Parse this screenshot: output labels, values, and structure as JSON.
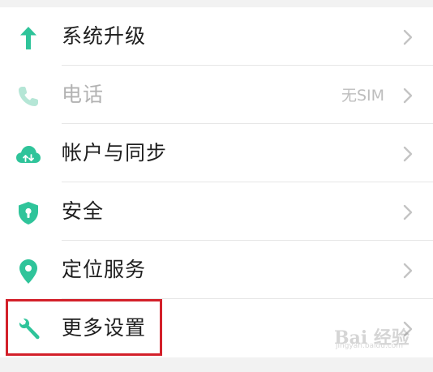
{
  "colors": {
    "accent": "#2fc49a",
    "disabled_icon": "#b5e6d6",
    "highlight_border": "#d3202a"
  },
  "settings": {
    "items": [
      {
        "label": "系统升级",
        "icon": "arrow-up-icon",
        "value": "",
        "enabled": true
      },
      {
        "label": "电话",
        "icon": "phone-icon",
        "value": "无SIM",
        "enabled": false
      },
      {
        "label": "帐户与同步",
        "icon": "cloud-sync-icon",
        "value": "",
        "enabled": true
      },
      {
        "label": "安全",
        "icon": "shield-lock-icon",
        "value": "",
        "enabled": true
      },
      {
        "label": "定位服务",
        "icon": "location-pin-icon",
        "value": "",
        "enabled": true
      },
      {
        "label": "更多设置",
        "icon": "wrench-icon",
        "value": "",
        "enabled": true
      }
    ]
  },
  "watermark": {
    "brand": "Bai 经验",
    "sub": "jingyan.baidu.com"
  }
}
